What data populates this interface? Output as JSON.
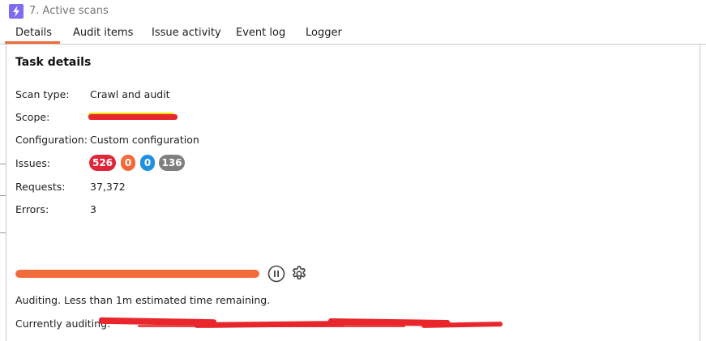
{
  "window": {
    "title": "7. Active scans"
  },
  "tabs": [
    {
      "label": "Details",
      "selected": true
    },
    {
      "label": "Audit items",
      "selected": false
    },
    {
      "label": "Issue activity",
      "selected": false
    },
    {
      "label": "Event log",
      "selected": false
    },
    {
      "label": "Logger",
      "selected": false
    }
  ],
  "task": {
    "title": "Task details",
    "scan_type_label": "Scan type:",
    "scan_type_value": "Crawl and audit",
    "scope_label": "Scope:",
    "configuration_label": "Configuration:",
    "configuration_value": "Custom configuration",
    "issues_label": "Issues:",
    "issues": {
      "high": "526",
      "medium": "0",
      "low": "0",
      "info": "136"
    },
    "requests_label": "Requests:",
    "requests_value": "37,372",
    "errors_label": "Errors:",
    "errors_value": "3"
  },
  "progress": {
    "percent": 100
  },
  "status": {
    "message": "Auditing. Less than 1m estimated time remaining.",
    "current_label": "Currently auditing:"
  },
  "icons": {
    "app": "burp-lightning-icon",
    "pause": "pause-icon",
    "settings": "gear-icon"
  },
  "colors": {
    "accent": "#f26b37",
    "badge_high": "#e0263b",
    "badge_medium": "#f26b37",
    "badge_low": "#1e8fe1",
    "badge_info": "#7f7f7f",
    "redaction": "#e8262b"
  }
}
